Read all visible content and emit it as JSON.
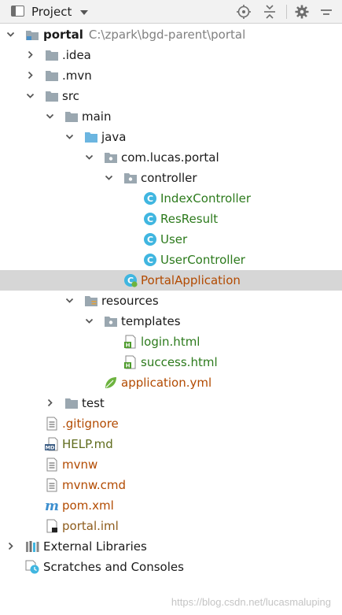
{
  "toolbar": {
    "title": "Project",
    "buttons": [
      "locate-icon",
      "collapse-all-icon",
      "settings-icon",
      "hide-icon"
    ]
  },
  "tree": {
    "root": {
      "name": "portal",
      "path": "C:\\zpark\\bgd-parent\\portal"
    },
    "idea": ".idea",
    "mvn": ".mvn",
    "src": "src",
    "main": "main",
    "java": "java",
    "package": "com.lucas.portal",
    "controller": "controller",
    "classes": [
      "IndexController",
      "ResResult",
      "User",
      "UserController"
    ],
    "app_class": "PortalApplication",
    "resources": "resources",
    "templates": "templates",
    "html_files": [
      "login.html",
      "success.html"
    ],
    "yml": "application.yml",
    "test": "test",
    "root_files": [
      ".gitignore",
      "HELP.md",
      "mvnw",
      "mvnw.cmd",
      "pom.xml",
      "portal.iml"
    ],
    "external_libraries": "External Libraries",
    "scratches": "Scratches and Consoles"
  },
  "colors": {
    "selected_row": "#d6d6d6",
    "green_text": "#2c7a1c",
    "orange_text": "#b24a00",
    "folder": "#9aa7b0",
    "source_folder": "#6bb5e0",
    "class_icon": "#40b6e0"
  },
  "watermark": "https://blog.csdn.net/lucasmaluping"
}
